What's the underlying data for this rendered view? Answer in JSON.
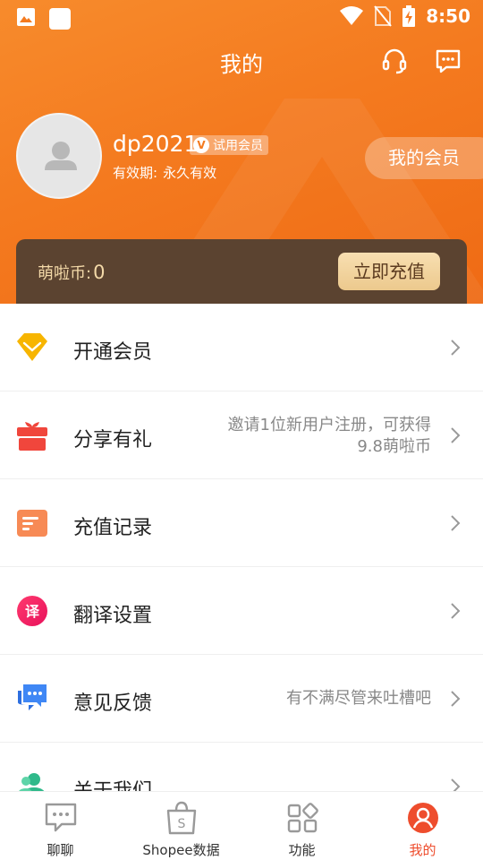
{
  "status_bar": {
    "time": "8:50"
  },
  "nav": {
    "title": "我的"
  },
  "profile": {
    "username": "dp2021",
    "badge": "试用会员",
    "validity_label": "有效期:",
    "validity_value": "永久有效",
    "member_button": "我的会员"
  },
  "coins": {
    "label": "萌啦币:",
    "value": "0",
    "recharge_button": "立即充值"
  },
  "menu": [
    {
      "label": "开通会员",
      "sub": ""
    },
    {
      "label": "分享有礼",
      "sub_line1": "邀请1位新用户注册，可获得",
      "sub_line2": "9.8萌啦币"
    },
    {
      "label": "充值记录",
      "sub": ""
    },
    {
      "label": "翻译设置",
      "sub": ""
    },
    {
      "label": "意见反馈",
      "sub": "有不满尽管来吐槽吧"
    },
    {
      "label": "关于我们",
      "sub": ""
    }
  ],
  "tabs": [
    {
      "label": "聊聊",
      "icon": "chat-icon"
    },
    {
      "label": "Shopee数据",
      "icon": "shopee-bag-icon"
    },
    {
      "label": "功能",
      "icon": "grid-icon"
    },
    {
      "label": "我的",
      "icon": "profile-icon",
      "active": true
    }
  ],
  "colors": {
    "brand_orange": "#f47a1f",
    "coin_card": "#5b4330",
    "active_tab": "#ee4d2d"
  }
}
